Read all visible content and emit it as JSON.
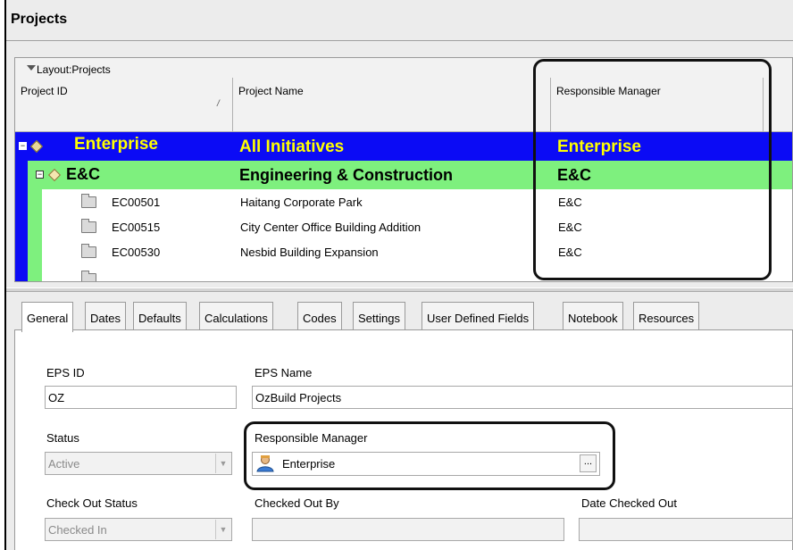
{
  "panel": {
    "title": "Projects"
  },
  "grid": {
    "layout_label": "Layout:Projects",
    "columns": {
      "project_id": "Project ID",
      "project_name": "Project Name",
      "responsible_manager": "Responsible Manager"
    },
    "enterprise_row": {
      "id": "Enterprise",
      "name": "All Initiatives",
      "manager": "Enterprise"
    },
    "ec_row": {
      "id": "E&C",
      "name": "Engineering & Construction",
      "manager": "E&C"
    },
    "projects": [
      {
        "id": "EC00501",
        "name": "Haitang Corporate Park",
        "manager": "E&C"
      },
      {
        "id": "EC00515",
        "name": "City Center Office Building Addition",
        "manager": "E&C"
      },
      {
        "id": "EC00530",
        "name": "Nesbid Building Expansion",
        "manager": "E&C"
      }
    ]
  },
  "tabs": [
    "General",
    "Dates",
    "Defaults",
    "Calculations",
    "Codes",
    "Settings",
    "User Defined Fields",
    "Notebook",
    "Resources"
  ],
  "general": {
    "eps_id_label": "EPS ID",
    "eps_id_value": "OZ",
    "eps_name_label": "EPS Name",
    "eps_name_value": "OzBuild Projects",
    "status_label": "Status",
    "status_value": "Active",
    "responsible_manager_label": "Responsible Manager",
    "responsible_manager_value": "Enterprise",
    "ellipsis": "...",
    "check_out_status_label": "Check Out Status",
    "check_out_status_value": "Checked In",
    "checked_out_by_label": "Checked Out By",
    "date_checked_out_label": "Date Checked Out"
  },
  "colors": {
    "enterprise_row": "#0b0bf5",
    "ec_row": "#7ef07e",
    "highlight_text": "#ffff00"
  }
}
